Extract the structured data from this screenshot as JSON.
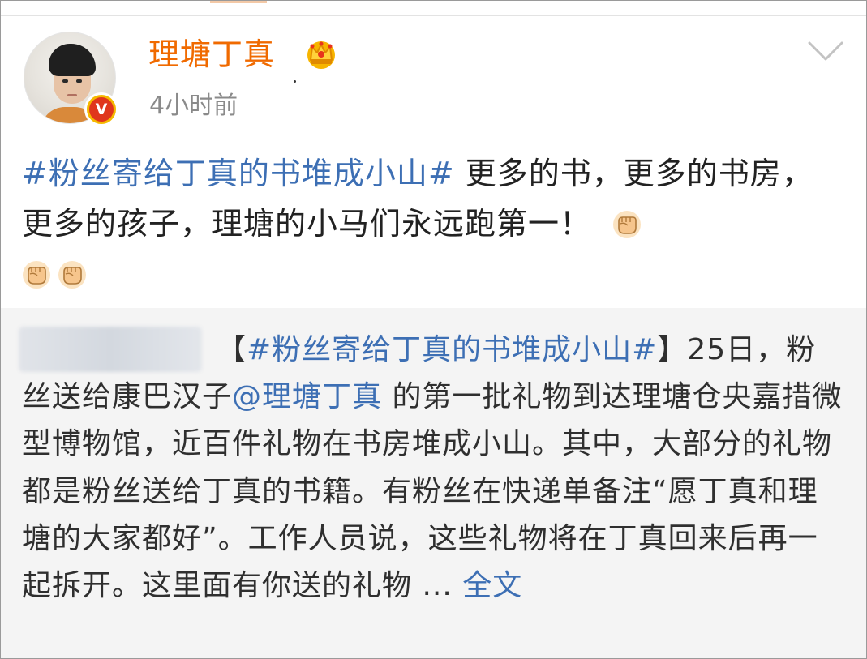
{
  "post": {
    "username": "理塘丁真",
    "timestamp": "4小时前",
    "verified_badge": "V",
    "text_topic": "#粉丝寄给丁真的书堆成小山#",
    "text_body": " 更多的书，更多的书房，更多的孩子，理塘的小马们永远跑第一！",
    "emojis": [
      "fist-emoji",
      "fist-emoji",
      "fist-emoji"
    ]
  },
  "repost": {
    "bracket_open": "【",
    "topic": "#粉丝寄给丁真的书堆成小山#",
    "bracket_close": "】",
    "text_part1": "25日，粉丝送给康巴汉子",
    "mention": "@理塘丁真",
    "text_part2": " 的第一批礼物到达理塘仓央嘉措微型博物馆，近百件礼物在书房堆成小山。其中，大部分的礼物都是粉丝送给丁真的书籍。有粉丝在快递单备注“愿丁真和理塘的大家都好”。工作人员说，这些礼物将在丁真回来后再一起拆开。这里面有你送的礼物 ... ",
    "more_link": "全文"
  },
  "colors": {
    "username": "#f06a00",
    "link": "#3d6fb4",
    "repost_bg": "#f4f4f4",
    "timestamp": "#8a8a8a"
  },
  "icons": {
    "crown": "crown-icon",
    "chevron": "chevron-down-icon",
    "verified": "verified-icon"
  }
}
